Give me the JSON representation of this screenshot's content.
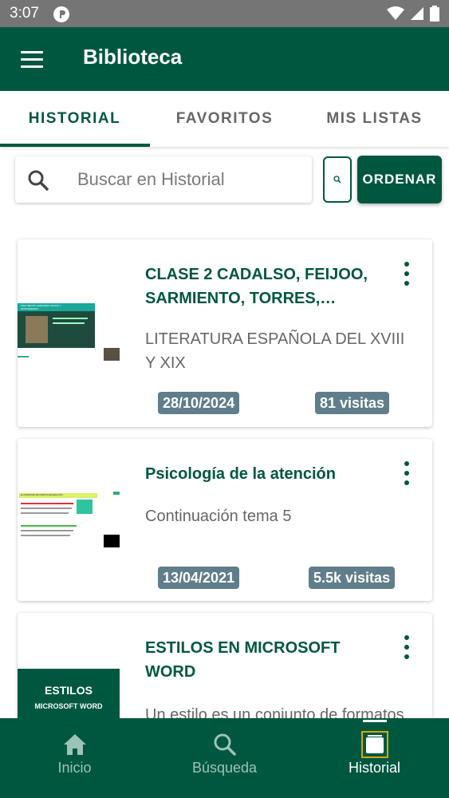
{
  "status_bar": {
    "time": "3:07"
  },
  "app_bar": {
    "title": "Biblioteca"
  },
  "tabs": [
    {
      "label": "HISTORIAL",
      "active": true
    },
    {
      "label": "FAVORITOS",
      "active": false
    },
    {
      "label": "MIS LISTAS",
      "active": false
    }
  ],
  "search": {
    "placeholder": "Buscar en Historial",
    "value": ""
  },
  "order_button": {
    "label": "ORDENAR"
  },
  "items": [
    {
      "title": "CLASE 2 CADALSO, FEIJOO, SARMIENTO, TORRES,…",
      "description": "LITERATURA ESPAÑOLA DEL XVIII Y XIX",
      "date": "28/10/2024",
      "visits": "81 visitas",
      "thumb_text": "FRAY BENITO JERONIMO FEIJOO Y MONTENEGRO"
    },
    {
      "title": "Psicología de la atención",
      "description": "Continuación tema 5",
      "date": "13/04/2021",
      "visits": "5.5k visitas",
      "thumb_text": "EL PARADIGMA DE TIEMPOS DE REACCIÓN"
    },
    {
      "title": "ESTILOS EN MICROSOFT WORD",
      "description": "Un estilo es un conjunto de formatos",
      "thumb_title": "ESTILOS",
      "thumb_subtitle": "MICROSOFT WORD"
    }
  ],
  "bottom_nav": [
    {
      "label": "Inicio",
      "icon": "home-icon"
    },
    {
      "label": "Búsqueda",
      "icon": "search-icon"
    },
    {
      "label": "Historial",
      "icon": "history-icon",
      "active": true
    }
  ],
  "colors": {
    "primary": "#00573f",
    "badge": "#607d8b",
    "status_bar": "#757575"
  }
}
